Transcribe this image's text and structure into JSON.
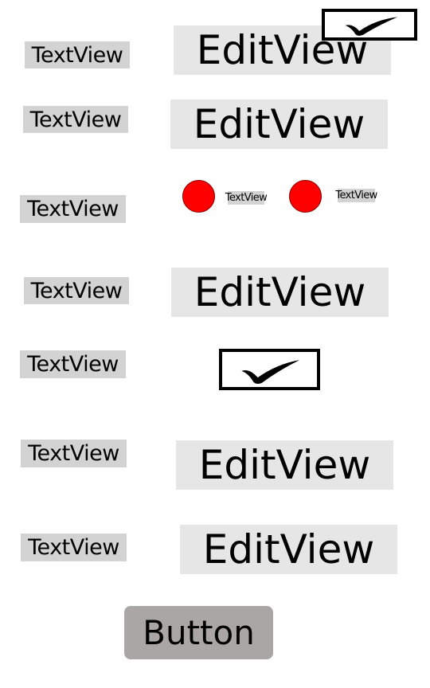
{
  "rows": [
    {
      "label": "TextView",
      "edit_value": "EditView"
    },
    {
      "label": "TextView",
      "edit_value": "EditView"
    },
    {
      "label": "TextView"
    },
    {
      "label": "TextView",
      "edit_value": "EditView"
    },
    {
      "label": "TextView"
    },
    {
      "label": "TextView",
      "edit_value": "EditView"
    },
    {
      "label": "TextView",
      "edit_value": "EditView"
    }
  ],
  "radio_group": [
    {
      "label": "TextView",
      "selected": true
    },
    {
      "label": "TextView",
      "selected": true
    }
  ],
  "checkboxes": {
    "top": {
      "checked": true
    },
    "middle": {
      "checked": true
    }
  },
  "button": {
    "label": "Button"
  },
  "colors": {
    "textview_bg": "#d3d3d3",
    "editview_bg": "#e6e6e6",
    "radio_fill": "#ff0000",
    "button_bg": "#aba6a6"
  }
}
